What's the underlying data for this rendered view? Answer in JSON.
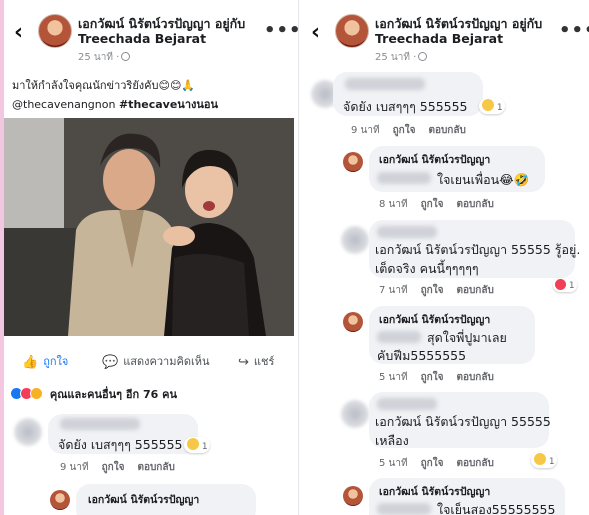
{
  "left": {
    "header": {
      "back_icon": "‹",
      "name_line1": "เอกวัฒน์ นิรัตน์วรปัญญา อยู่กับ",
      "name_line2": "Treechada Bejarat",
      "time": "25 นาที ·",
      "more": "•••"
    },
    "post": {
      "caption": "มาให้กำลังใจคุณนักข่าวริยังคับ😊😊🙏",
      "mention": "@thecavenangnon",
      "hashtag": "#thecaveนางนอน"
    },
    "actions": {
      "like": "ถูกใจ",
      "comment": "แสดงความคิดเห็น",
      "share": "แชร์"
    },
    "reactions_text": "คุณและคนอื่นๆ อีก 76 คน",
    "comments": [
      {
        "text": "จัดยัง เบสๆๆๆ 555555",
        "reaction_count": "1",
        "time": "9 นาที",
        "like": "ถูกใจ",
        "reply": "ตอบกลับ"
      },
      {
        "name": "เอกวัฒน์ นิรัตน์วรปัญญา"
      }
    ]
  },
  "right": {
    "header": {
      "back_icon": "‹",
      "name_line1": "เอกวัฒน์ นิรัตน์วรปัญญา อยู่กับ",
      "name_line2": "Treechada Bejarat",
      "time": "25 นาที ·",
      "more": "•••"
    },
    "comments": [
      {
        "text": "จัดยัง เบสๆๆๆ 555555",
        "reaction_count": "1",
        "time": "9 นาที",
        "like": "ถูกใจ",
        "reply": "ตอบกลับ"
      },
      {
        "name": "เอกวัฒน์ นิรัตน์วรปัญญา",
        "text": "ใจเยนเพื่อน😂🤣",
        "time": "8 นาที",
        "like": "ถูกใจ",
        "reply": "ตอบกลับ"
      },
      {
        "line1": "เอกวัฒน์ นิรัตน์วรปัญญา 55555 รู้อยู่.",
        "line2": "เต็ดจริง คนนี้ๆๆๆๆๆ",
        "reaction_count": "1",
        "time": "7 นาที",
        "like": "ถูกใจ",
        "reply": "ตอบกลับ"
      },
      {
        "name": "เอกวัฒน์ นิรัตน์วรปัญญา",
        "line1": "สุดใจพี่ปูมาเลย",
        "line2": "คับฟีม5555555",
        "time": "5 นาที",
        "like": "ถูกใจ",
        "reply": "ตอบกลับ"
      },
      {
        "line1": "เอกวัฒน์ นิรัตน์วรปัญญา 55555",
        "line2": "เหลือง",
        "reaction_count": "1",
        "time": "5 นาที",
        "like": "ถูกใจ",
        "reply": "ตอบกลับ"
      },
      {
        "name": "เอกวัฒน์ นิรัตน์วรปัญญา",
        "text": "ใจเย็นสอง55555555"
      }
    ]
  }
}
